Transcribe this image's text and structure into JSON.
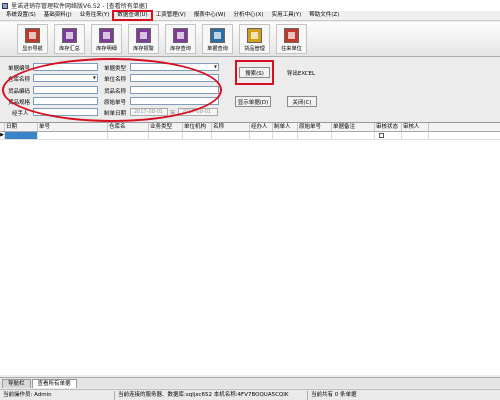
{
  "window": {
    "title": "里诺进销存管理软件网络版V6.52 - [查看所有单据]"
  },
  "menu": {
    "items": [
      {
        "label": "系统设置(S)",
        "highlighted": false
      },
      {
        "label": "基础资料(J)",
        "highlighted": false
      },
      {
        "label": "业务往来(Y)",
        "highlighted": false
      },
      {
        "label": "数据查询(U)",
        "highlighted": true
      },
      {
        "label": "工资管理(V)",
        "highlighted": false
      },
      {
        "label": "报表中心(W)",
        "highlighted": false
      },
      {
        "label": "分析中心(X)",
        "highlighted": false
      },
      {
        "label": "实用工具(Y)",
        "highlighted": false
      },
      {
        "label": "帮助文件(Z)",
        "highlighted": false
      }
    ]
  },
  "toolbar": {
    "buttons": [
      {
        "label": "显示导航",
        "icon": "navigation-icon",
        "color": "#c0392b"
      },
      {
        "label": "库存汇总",
        "icon": "inventory-summary-icon",
        "color": "#7d3c98"
      },
      {
        "label": "库存明细",
        "icon": "inventory-detail-icon",
        "color": "#7d3c98"
      },
      {
        "label": "库存报警",
        "icon": "inventory-alarm-icon",
        "color": "#7d3c98"
      },
      {
        "label": "库存查询",
        "icon": "inventory-query-icon",
        "color": "#7d3c98"
      },
      {
        "label": "单据查询",
        "icon": "document-query-icon",
        "color": "#2e6da4"
      },
      {
        "label": "货品管理",
        "icon": "goods-management-icon",
        "color": "#d4a017"
      },
      {
        "label": "往来单位",
        "icon": "partner-unit-icon",
        "color": "#c0392b"
      }
    ]
  },
  "form": {
    "doc_no_label": "单据编号",
    "doc_type_label": "单据类型",
    "warehouse_label": "仓库名称",
    "unit_label": "单位名称",
    "goods_code_label": "货品编码",
    "goods_name_label": "货品名称",
    "goods_spec_label": "货品规格",
    "orig_doc_label": "原始单号",
    "operator_label": "经手人",
    "date_label": "制单日期",
    "date_from": "2017-08-01",
    "date_to": "2017-08-01",
    "date_sep": "至",
    "search_label": "搜索(S)",
    "export_label": "导出EXCEL",
    "show_doc_label": "显示单据(D)",
    "close_label": "关闭(C)"
  },
  "grid": {
    "columns": [
      "日期",
      "单号",
      "仓库名",
      "业务类型",
      "单位机构",
      "名称",
      "经办人",
      "制单人",
      "原始单号",
      "单据备注",
      "审核状态",
      "审核人"
    ],
    "rows": [
      {
        "marker": "▶",
        "cells": [
          "",
          "",
          "",
          "",
          "",
          "",
          "",
          "",
          "",
          "",
          "",
          ""
        ]
      }
    ]
  },
  "tabs": [
    {
      "label": "导航栏",
      "active": false
    },
    {
      "label": "查看所有单据",
      "active": true
    }
  ],
  "status": {
    "operator": "当前操作员: Admin",
    "server": "当前连接的服务器、数据库:sqljxc652 本机名称:4FV7BOQUA5CQIK",
    "count": "当前共有 0 条单据"
  }
}
